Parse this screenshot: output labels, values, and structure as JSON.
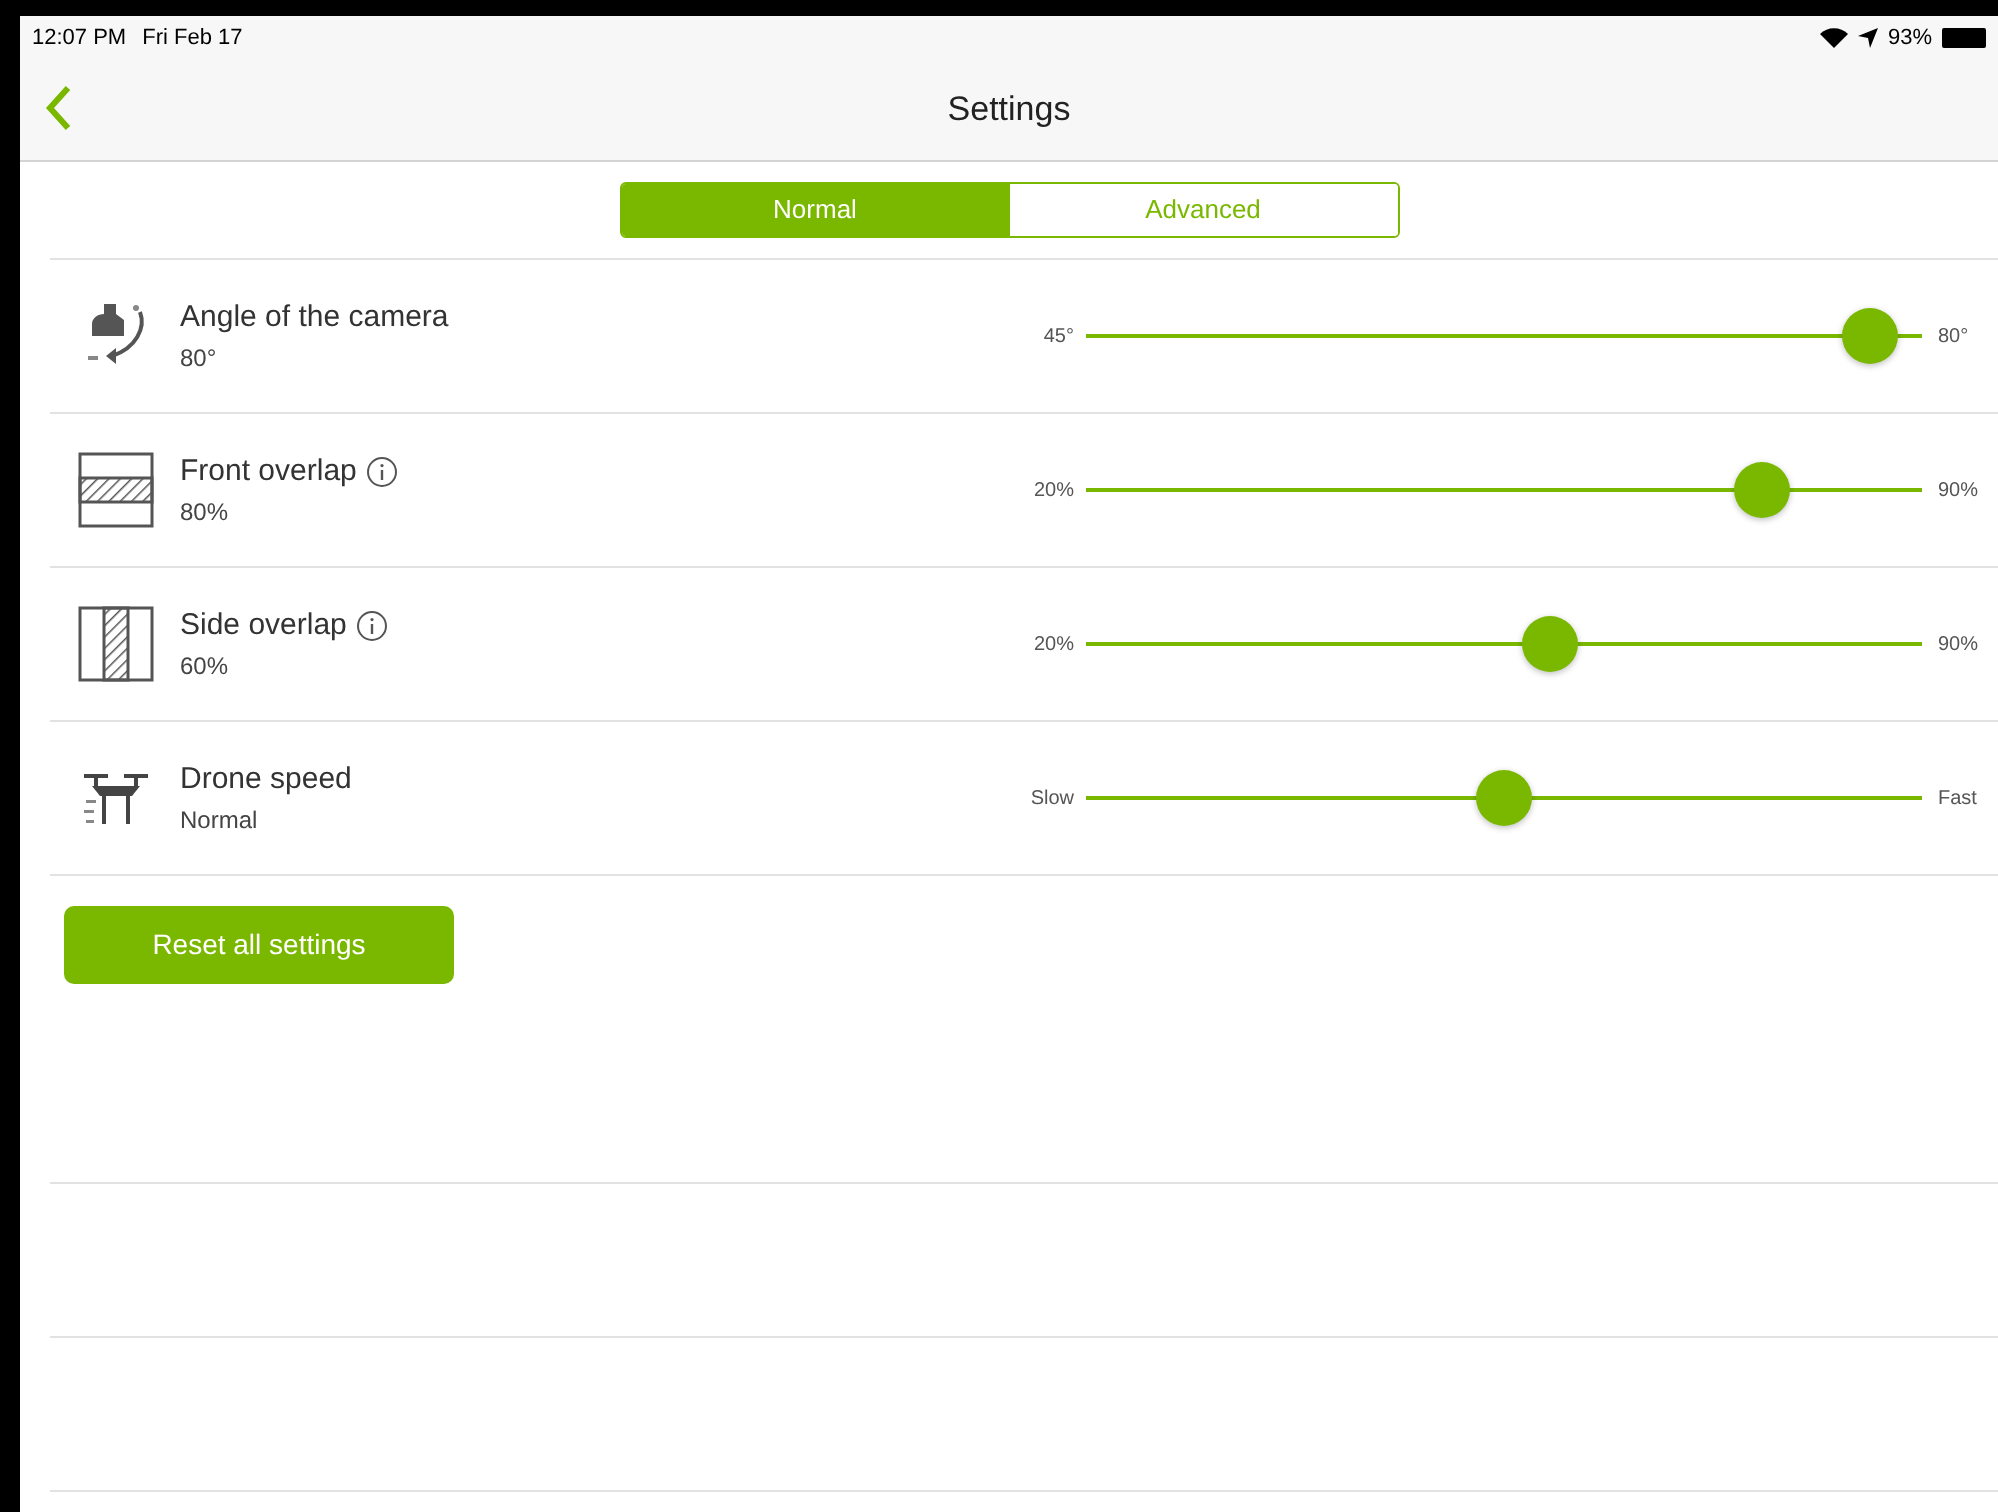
{
  "status_bar": {
    "time": "12:07 PM",
    "date": "Fri Feb 17",
    "battery": "93%"
  },
  "nav": {
    "title": "Settings"
  },
  "tabs": [
    {
      "label": "Normal",
      "selected": true
    },
    {
      "label": "Advanced",
      "selected": false
    }
  ],
  "settings": [
    {
      "kind": "camera",
      "name": "Angle of the camera",
      "value": "80°",
      "info": false,
      "min_label": "45°",
      "max_label": "80°",
      "level": 0.97
    },
    {
      "kind": "front",
      "name": "Front overlap",
      "value": "80%",
      "info": true,
      "min_label": "20%",
      "max_label": "90%",
      "level": 0.83
    },
    {
      "kind": "side",
      "name": "Side overlap",
      "value": "60%",
      "info": true,
      "min_label": "20%",
      "max_label": "90%",
      "level": 0.56
    },
    {
      "kind": "drone",
      "name": "Drone speed",
      "value": "Normal",
      "info": false,
      "min_label": "Slow",
      "max_label": "Fast",
      "level": 0.5
    }
  ],
  "reset_button": "Reset all settings"
}
